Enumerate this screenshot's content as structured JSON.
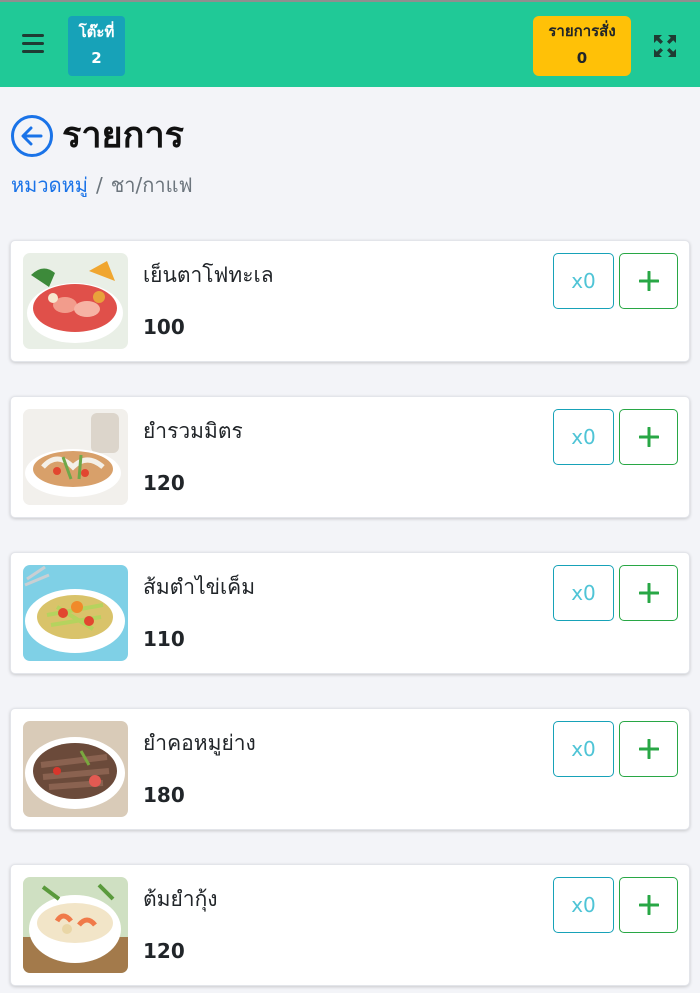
{
  "header": {
    "table_label": "โต๊ะที่",
    "table_number": "2",
    "order_label": "รายการสั่ง",
    "order_count": "0",
    "colors": {
      "bar": "#20c997",
      "table_badge": "#17a2b8",
      "order_button": "#ffc107"
    }
  },
  "page": {
    "title": "รายการ",
    "breadcrumb": {
      "parent": "หมวดหมู่",
      "separator": "/",
      "current": "ชา/กาแฟ"
    }
  },
  "items": [
    {
      "name": "เย็นตาโฟทะเล",
      "price": "100",
      "qty": "x0",
      "image": "yentafo-seafood-photo"
    },
    {
      "name": "ยำรวมมิตร",
      "price": "120",
      "qty": "x0",
      "image": "mixed-spicy-salad-photo"
    },
    {
      "name": "ส้มตำไข่เค็ม",
      "price": "110",
      "qty": "x0",
      "image": "papaya-salad-salted-egg-photo"
    },
    {
      "name": "ยำคอหมูย่าง",
      "price": "180",
      "qty": "x0",
      "image": "grilled-pork-neck-salad-photo"
    },
    {
      "name": "ต้มยำกุ้ง",
      "price": "120",
      "qty": "x0",
      "image": "tom-yum-shrimp-photo"
    }
  ],
  "icons": {
    "menu": "hamburger-icon",
    "expand": "expand-arrows-icon",
    "back": "arrow-left-circle-icon",
    "add": "plus-icon"
  }
}
